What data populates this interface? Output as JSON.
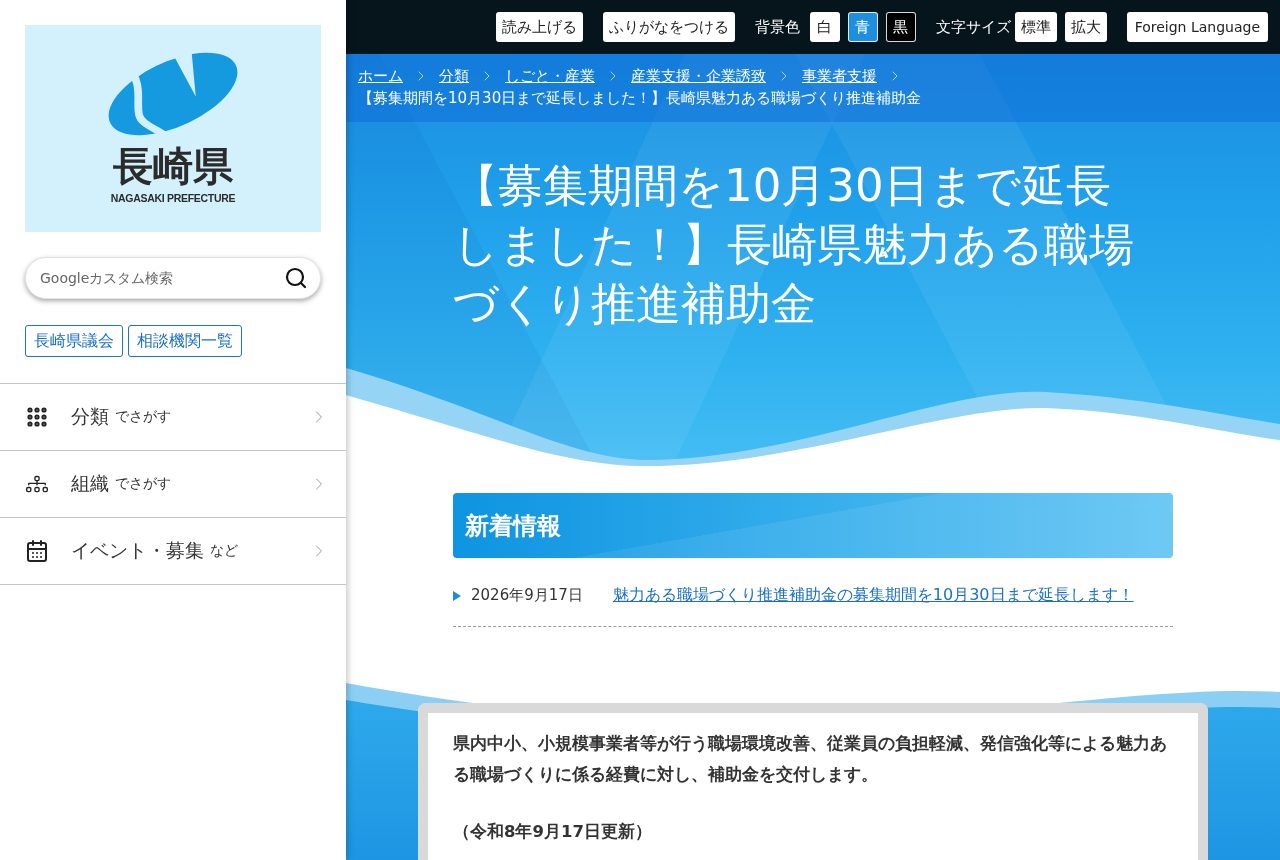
{
  "top_bar": {
    "buttons": [
      {
        "label": "読み上げる"
      },
      {
        "label": "ふりがなをつける"
      }
    ],
    "background_color": {
      "label": "背景色",
      "options": [
        {
          "label": "白",
          "color": "#ffffff"
        },
        {
          "label": "青",
          "color": "#1e8fe0"
        },
        {
          "label": "黒",
          "color": "#000000"
        }
      ]
    },
    "text_size": {
      "label": "文字サイズ",
      "options": [
        {
          "label": "標準"
        },
        {
          "label": "拡大"
        }
      ]
    },
    "language_button": "Foreign Language"
  },
  "sidebar": {
    "logo": {
      "name": "長崎県",
      "subtitle": "NAGASAKI PREFECTURE"
    },
    "search": {
      "placeholder": "Googleカスタム検索"
    },
    "quick_links": [
      "長崎県議会",
      "相談機関一覧"
    ],
    "nav": [
      {
        "kind": "category",
        "label": "分類",
        "suffix": "でさがす"
      },
      {
        "kind": "organization",
        "label": "組織",
        "suffix": "でさがす"
      },
      {
        "kind": "event",
        "label": "イベント・募集",
        "suffix": "など"
      }
    ]
  },
  "breadcrumb": {
    "links": [
      "ホーム",
      "分類",
      "しごと・産業",
      "産業支援・企業誘致",
      "事業者支援"
    ],
    "current": "【募集期間を10月30日まで延長しました！】長崎県魅力ある職場づくり推進補助金"
  },
  "page_title": "【募集期間を10月30日まで延長しました！】長崎県魅力ある職場づくり推進補助金",
  "news": {
    "heading": "新着情報",
    "items": [
      {
        "date": "2026年9月17日",
        "title": "魅力ある職場づくり推進補助金の募集期間を10月30日まで延長します！"
      }
    ]
  },
  "body": {
    "paragraph": "県内中小、小規模事業者等が行う職場環境改善、従業員の負担軽減、発信強化等による魅力ある職場づくりに係る経費に対し、補助金を交付します。",
    "updated": "（令和8年9月17日更新）"
  }
}
